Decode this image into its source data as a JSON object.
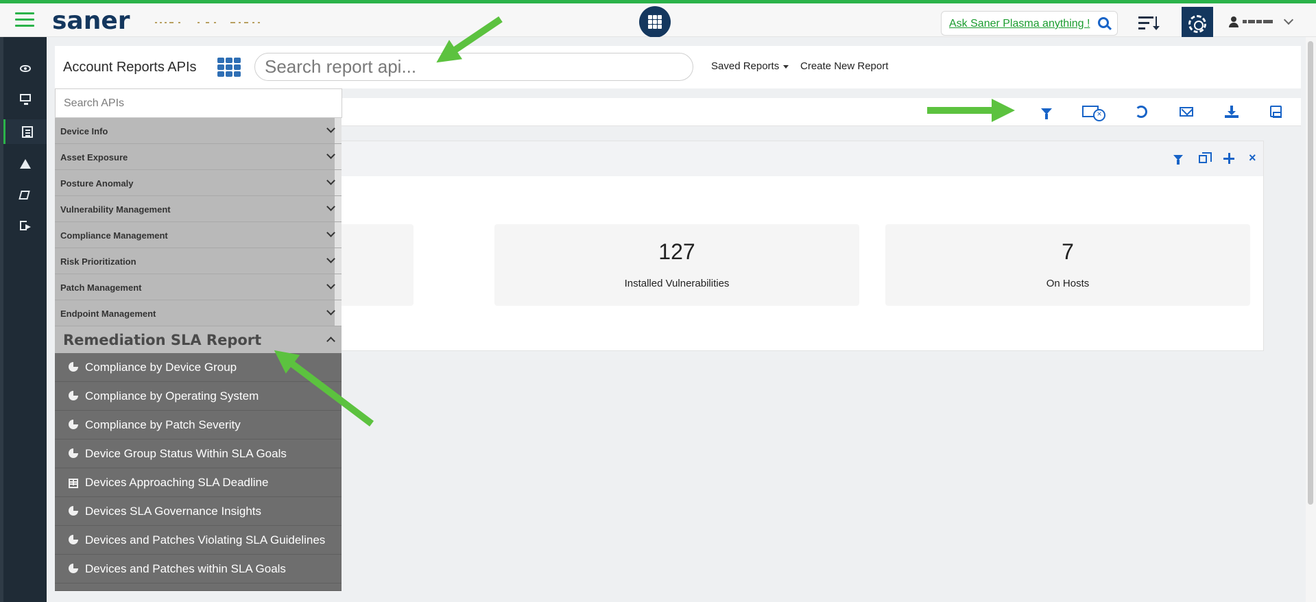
{
  "header": {
    "brand": "saner",
    "ask_placeholder_text": "Ask Saner Plasma anything !",
    "icons": [
      "hamburger-icon",
      "app-grid-icon",
      "search-icon",
      "sort-icon",
      "gear-icon",
      "user-icon",
      "chevron-down-icon"
    ]
  },
  "sidebar": {
    "items": [
      {
        "icon": "eye-icon"
      },
      {
        "icon": "monitor-icon"
      },
      {
        "icon": "report-list-icon",
        "active": true
      },
      {
        "icon": "warning-icon"
      },
      {
        "icon": "book-icon"
      },
      {
        "icon": "logout-icon"
      }
    ]
  },
  "toolbar": {
    "title": "Account Reports APIs",
    "search_placeholder": "Search report api...",
    "saved_reports": "Saved Reports",
    "create_report": "Create New Report"
  },
  "subbar": {
    "icons": [
      "filter-icon",
      "monitor-close-icon",
      "refresh-icon",
      "mail-icon",
      "download-icon",
      "save-icon"
    ]
  },
  "widget": {
    "header_icons": [
      "filter-icon",
      "restore-icon",
      "move-icon",
      "close-icon"
    ],
    "stats": [
      {
        "value": "127",
        "label": "Installed Vulnerabilities"
      },
      {
        "value": "7",
        "label": "On Hosts"
      }
    ]
  },
  "api_panel": {
    "search_placeholder": "Search APIs",
    "categories": [
      {
        "label": "Device Info"
      },
      {
        "label": "Asset Exposure"
      },
      {
        "label": "Posture Anomaly"
      },
      {
        "label": "Vulnerability Management"
      },
      {
        "label": "Compliance Management"
      },
      {
        "label": "Risk Prioritization"
      },
      {
        "label": "Patch Management"
      },
      {
        "label": "Endpoint Management"
      }
    ],
    "expanded": {
      "label": "Remediation SLA Report",
      "items": [
        {
          "label": "Compliance by Device Group",
          "icon": "pie-chart-icon"
        },
        {
          "label": "Compliance by Operating System",
          "icon": "pie-chart-icon"
        },
        {
          "label": "Compliance by Patch Severity",
          "icon": "pie-chart-icon"
        },
        {
          "label": "Device Group Status Within SLA Goals",
          "icon": "pie-chart-icon"
        },
        {
          "label": "Devices Approaching SLA Deadline",
          "icon": "table-icon"
        },
        {
          "label": "Devices SLA Governance Insights",
          "icon": "pie-chart-icon"
        },
        {
          "label": "Devices and Patches Violating SLA Guidelines",
          "icon": "pie-chart-icon"
        },
        {
          "label": "Devices and Patches within SLA Goals",
          "icon": "pie-chart-icon"
        }
      ]
    }
  },
  "colors": {
    "accent_green": "#2bb34a",
    "brand_navy": "#14375e",
    "icon_blue": "#1763c7",
    "arrow_green": "#5cc23f"
  }
}
